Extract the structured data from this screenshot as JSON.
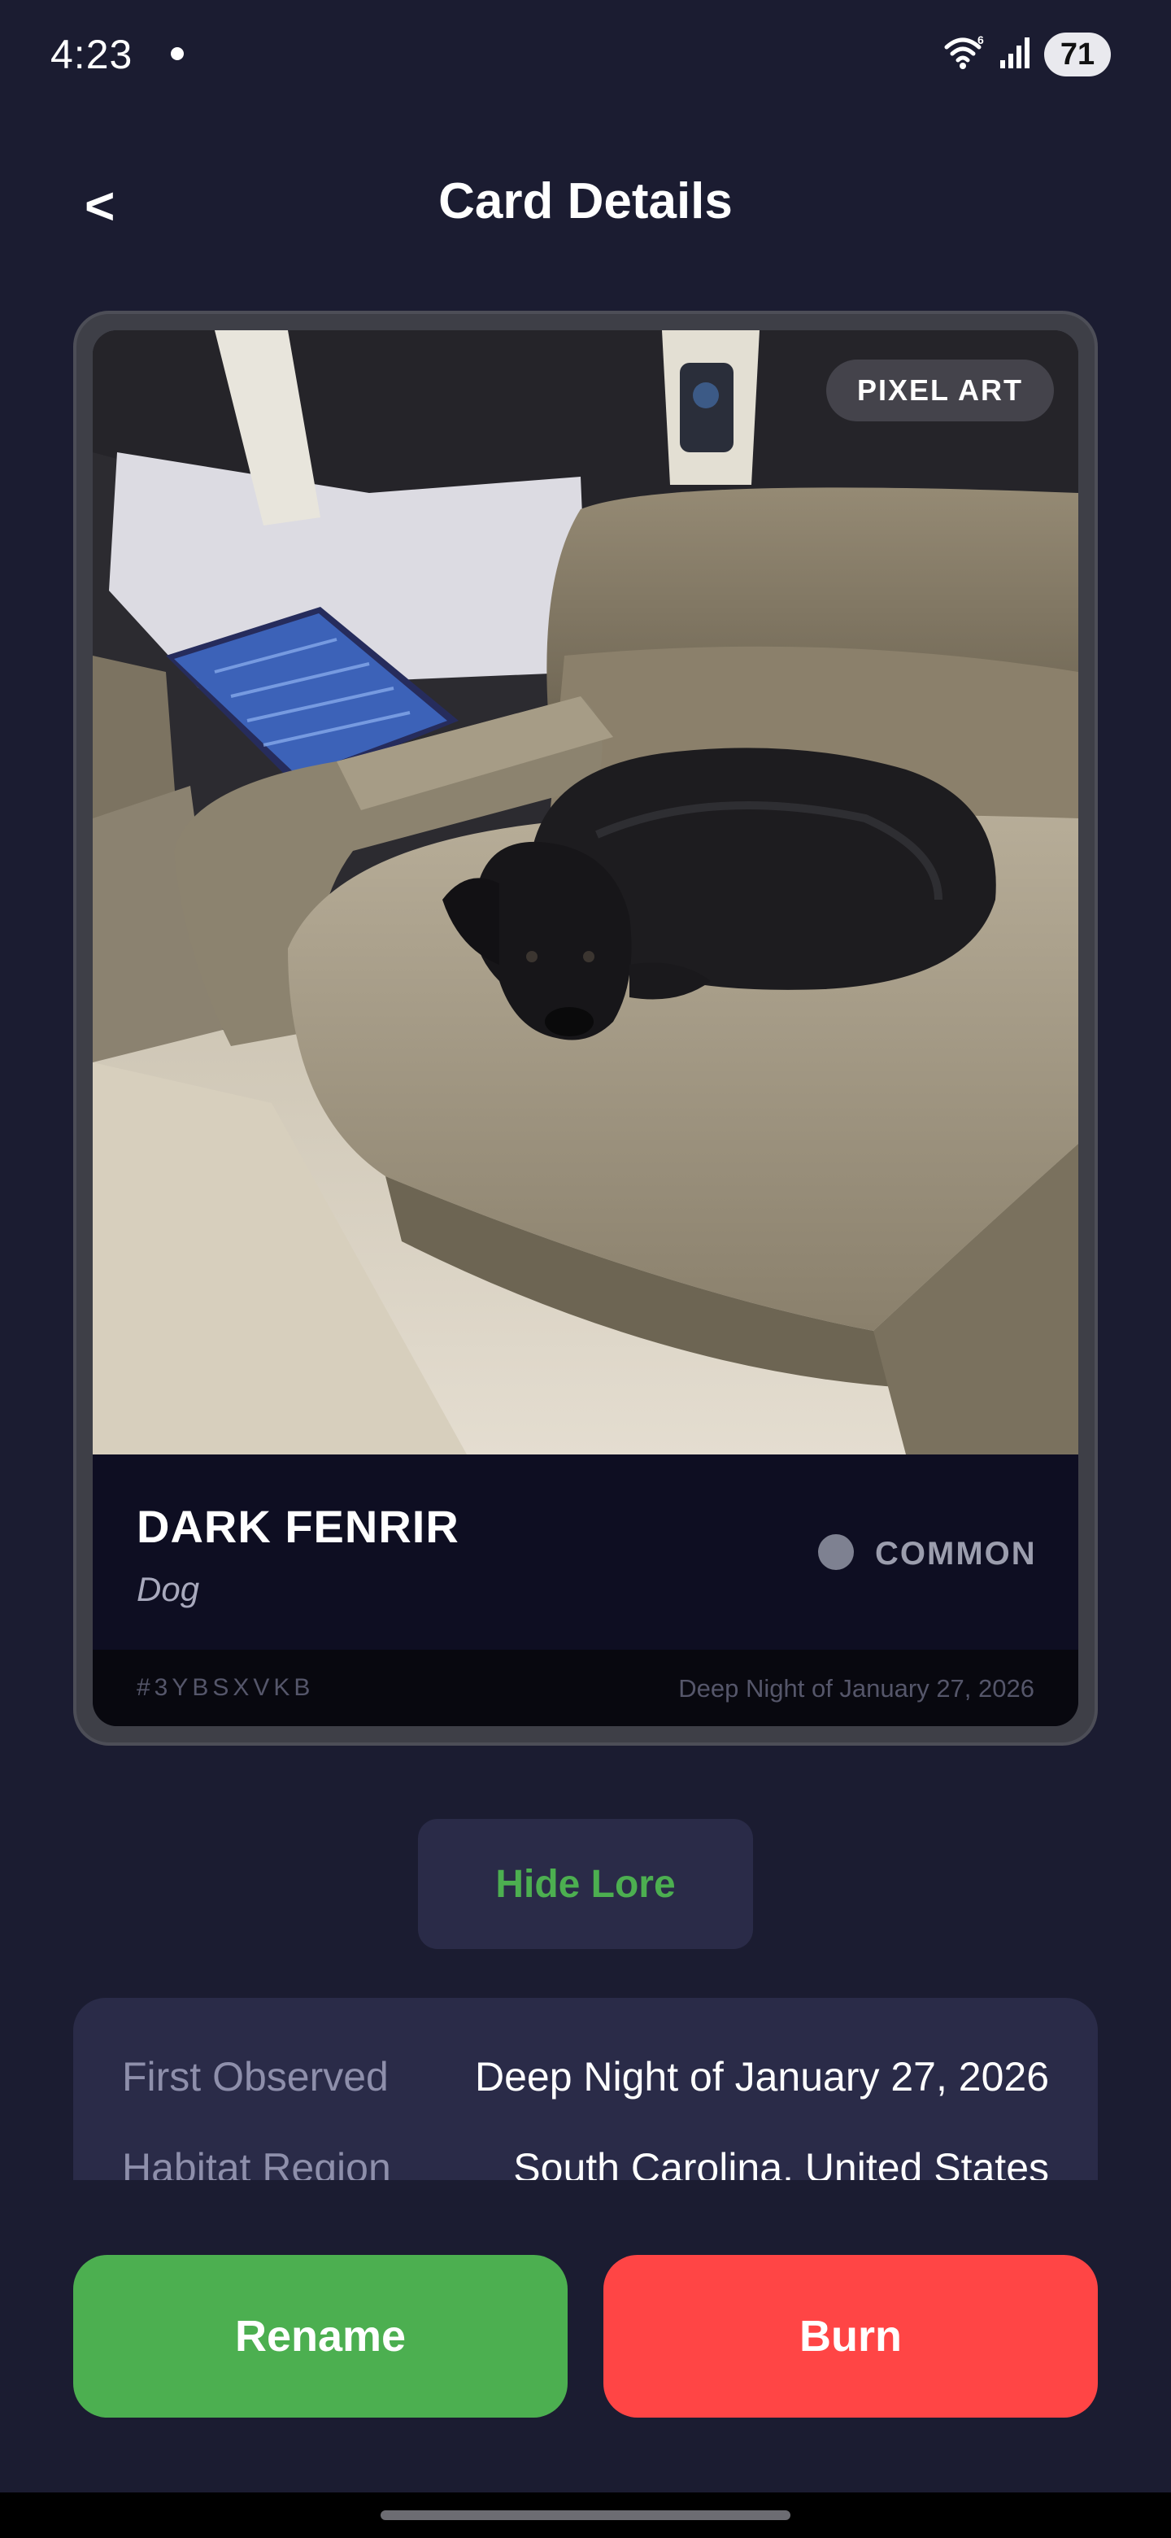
{
  "status_bar": {
    "time": "4:23",
    "battery": "71"
  },
  "header": {
    "back_label": "<",
    "title": "Card Details"
  },
  "card": {
    "style_badge": "PIXEL ART",
    "name": "DARK FENRIR",
    "species": "Dog",
    "rarity": "COMMON",
    "id": "#3YBSXVKB",
    "date": "Deep Night of January 27, 2026",
    "image_alt": "black dog curled up on a beige leather couch"
  },
  "lore_toggle_label": "Hide Lore",
  "lore": {
    "rows": [
      {
        "label": "First Observed",
        "value": "Deep Night of January 27, 2026"
      },
      {
        "label": "Habitat Region",
        "value": "South Carolina, United States"
      }
    ]
  },
  "actions": {
    "rename_label": "Rename",
    "burn_label": "Burn"
  },
  "colors": {
    "background": "#1b1c31",
    "accent_green": "#4caf50",
    "danger_red": "#ff4545",
    "panel": "#2a2b48"
  }
}
